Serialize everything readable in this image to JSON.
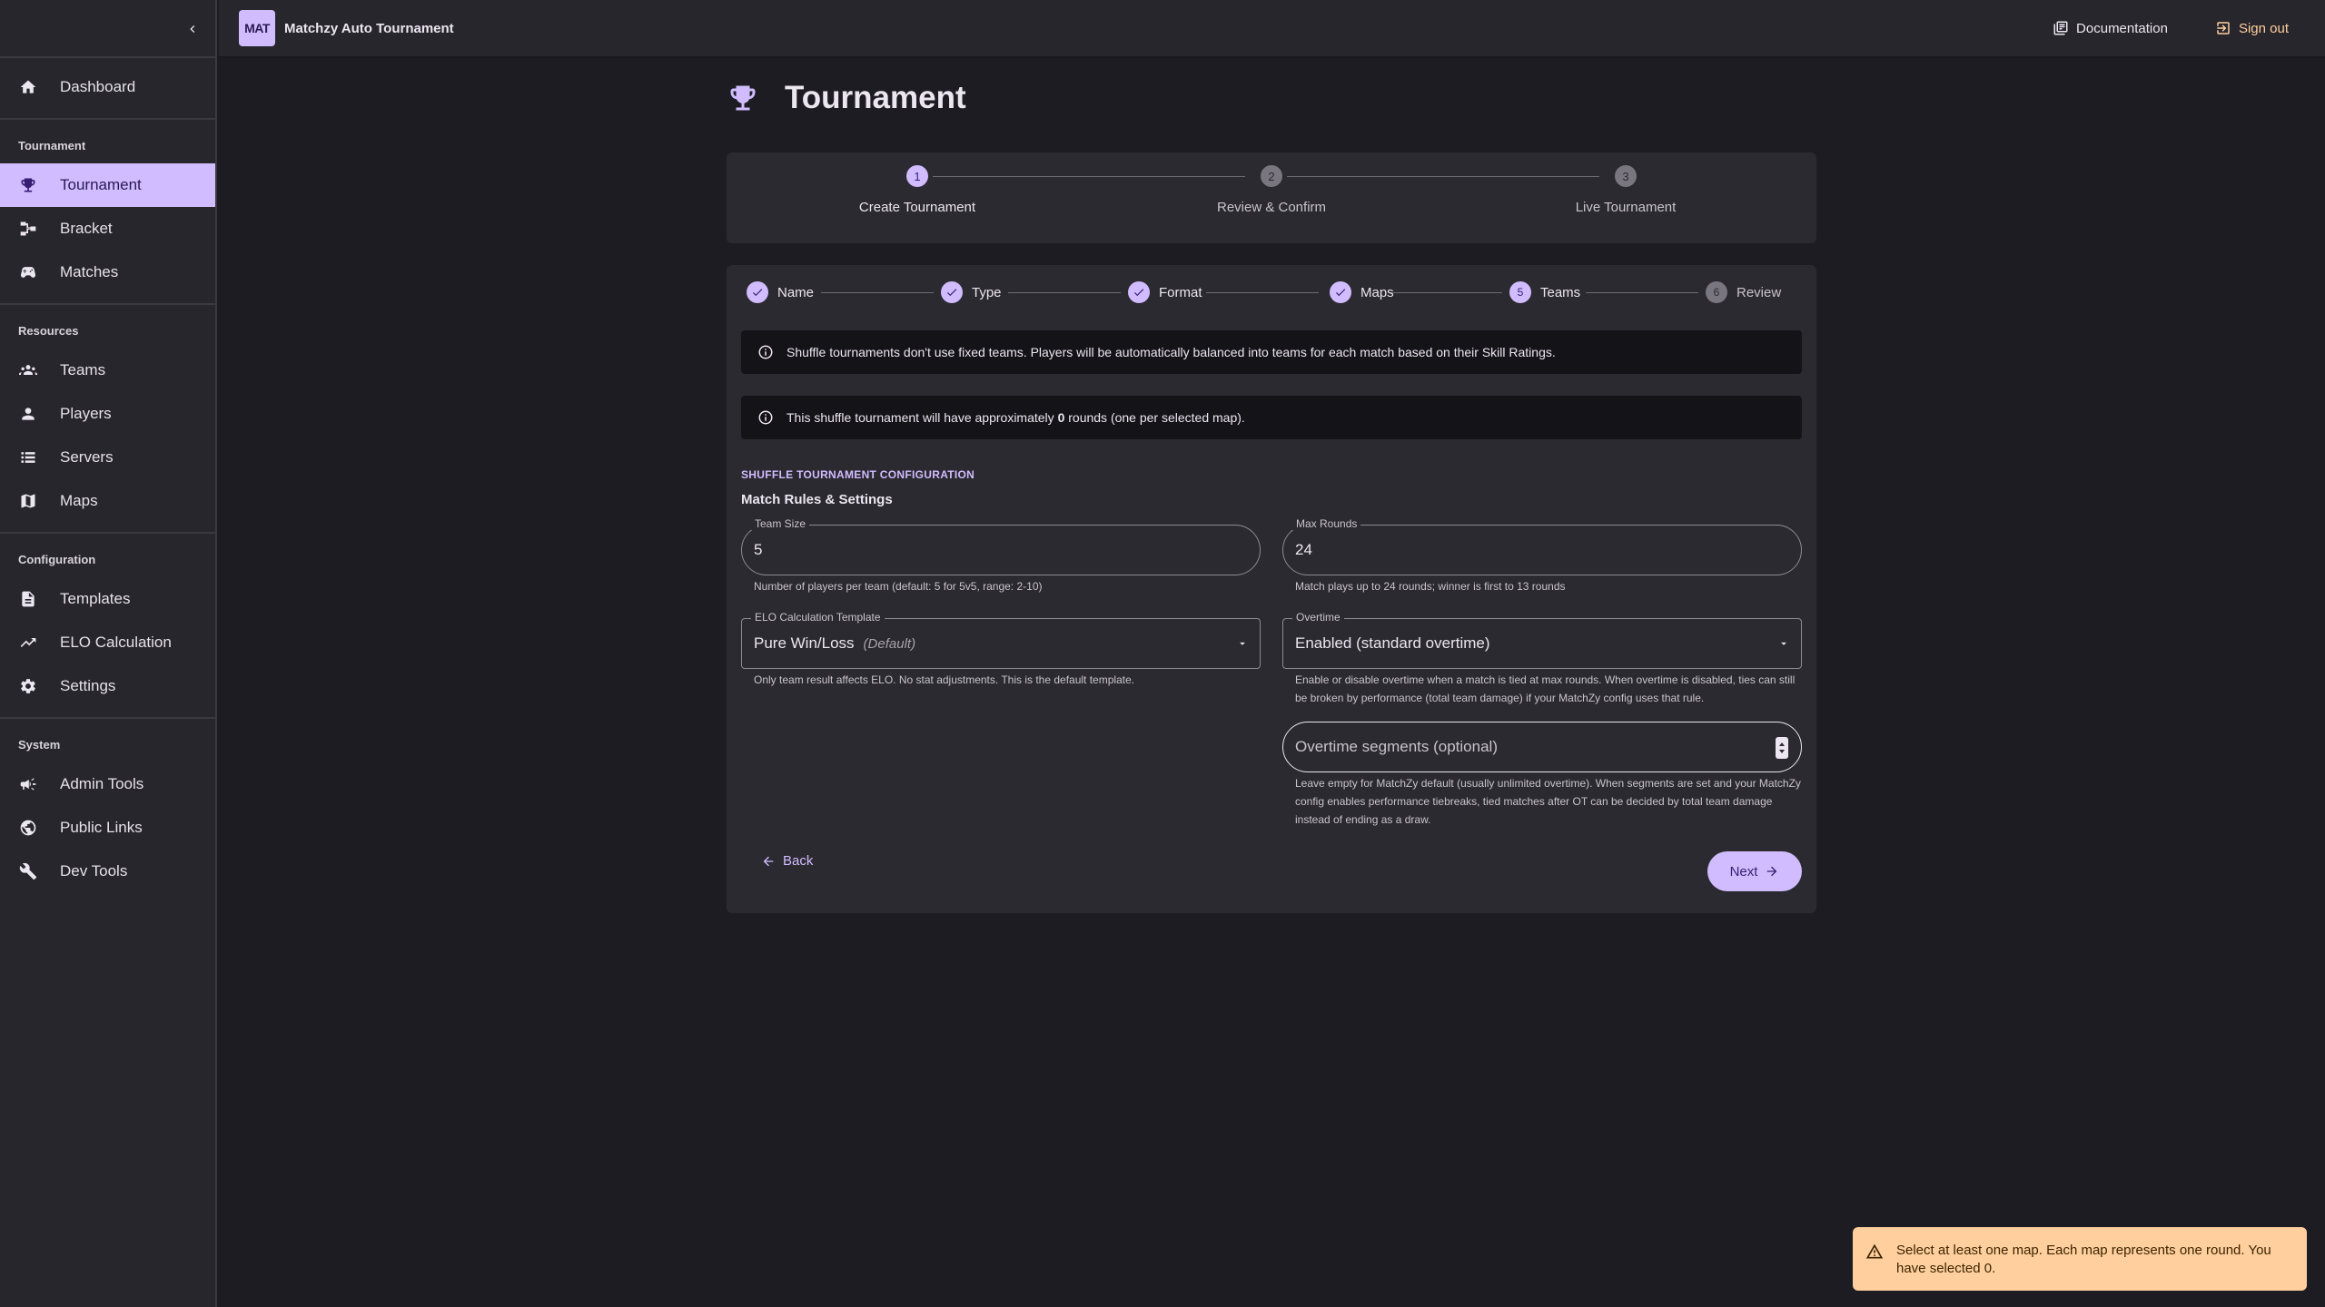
{
  "app": {
    "logo_text": "MAT",
    "title": "Matchzy Auto Tournament"
  },
  "topbar": {
    "documentation": "Documentation",
    "sign_out": "Sign out"
  },
  "sidebar": {
    "dashboard": "Dashboard",
    "tournament_header": "Tournament",
    "tournament": "Tournament",
    "bracket": "Bracket",
    "matches": "Matches",
    "resources_header": "Resources",
    "teams": "Teams",
    "players": "Players",
    "servers": "Servers",
    "maps": "Maps",
    "configuration_header": "Configuration",
    "templates": "Templates",
    "elo": "ELO Calculation",
    "settings": "Settings",
    "system_header": "System",
    "admin_tools": "Admin Tools",
    "public_links": "Public Links",
    "dev_tools": "Dev Tools"
  },
  "page": {
    "title": "Tournament"
  },
  "stepper": [
    {
      "num": "1",
      "label": "Create Tournament"
    },
    {
      "num": "2",
      "label": "Review & Confirm"
    },
    {
      "num": "3",
      "label": "Live Tournament"
    }
  ],
  "substeps": [
    {
      "num": "",
      "label": "Name",
      "state": "done"
    },
    {
      "num": "",
      "label": "Type",
      "state": "done"
    },
    {
      "num": "",
      "label": "Format",
      "state": "done"
    },
    {
      "num": "",
      "label": "Maps",
      "state": "done"
    },
    {
      "num": "5",
      "label": "Teams",
      "state": "current"
    },
    {
      "num": "6",
      "label": "Review",
      "state": "todo"
    }
  ],
  "alerts": {
    "shuffle_info": "Shuffle tournaments don't use fixed teams. Players will be automatically balanced into teams for each match based on their Skill Ratings.",
    "rounds_prefix": "This shuffle tournament will have approximately",
    "rounds_count": "0",
    "rounds_suffix": "rounds (one per selected map)."
  },
  "config": {
    "section_title": "SHUFFLE TOURNAMENT CONFIGURATION",
    "subtitle": "Match Rules & Settings",
    "team_size": {
      "label": "Team Size",
      "value": "5",
      "helper": "Number of players per team (default: 5 for 5v5, range: 2-10)"
    },
    "max_rounds": {
      "label": "Max Rounds",
      "value": "24",
      "helper": "Match plays up to 24 rounds; winner is first to 13 rounds"
    },
    "elo_template": {
      "label": "ELO Calculation Template",
      "value": "Pure Win/Loss",
      "tag": "(Default)",
      "helper": "Only team result affects ELO. No stat adjustments. This is the default template."
    },
    "overtime": {
      "label": "Overtime",
      "value": "Enabled (standard overtime)",
      "helper": "Enable or disable overtime when a match is tied at max rounds. When overtime is disabled, ties can still be broken by performance (total team damage) if your MatchZy config uses that rule."
    },
    "ot_segments": {
      "placeholder": "Overtime segments (optional)",
      "helper": "Leave empty for MatchZy default (usually unlimited overtime). When segments are set and your MatchZy config enables performance tiebreaks, tied matches after OT can be decided by total team damage instead of ending as a draw."
    }
  },
  "actions": {
    "back": "Back",
    "next": "Next"
  },
  "toast": {
    "message": "Select at least one map. Each map represents one round. You have selected 0."
  },
  "colors": {
    "accent": "#d0bcff",
    "warning": "#ffcf9e",
    "background": "#1d1c22",
    "surface": "#2b2a30"
  }
}
